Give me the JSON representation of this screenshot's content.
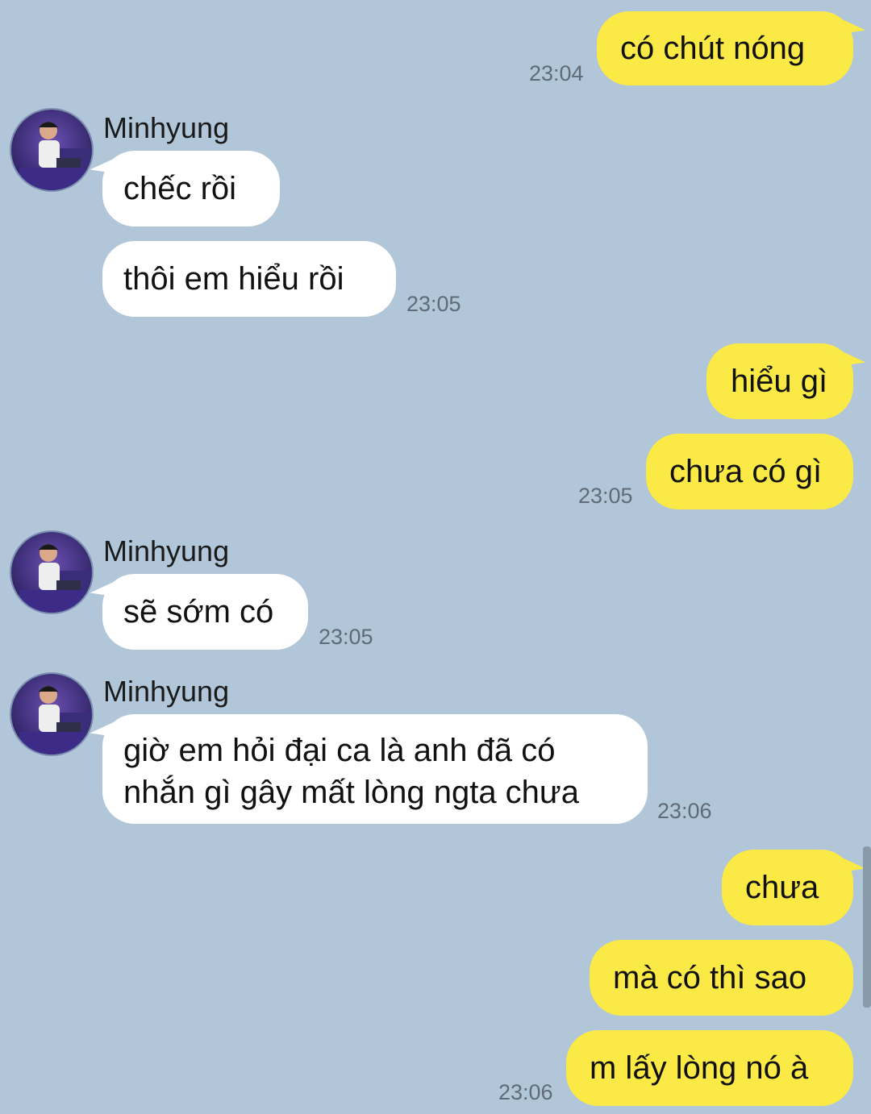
{
  "contact": {
    "name": "Minhyung",
    "avatar_icon": "contact-avatar-photo"
  },
  "colors": {
    "background": "#b1c6d9",
    "sent_bubble": "#fbea45",
    "received_bubble": "#ffffff"
  },
  "messages": [
    {
      "direction": "sent",
      "text": "có chút nóng",
      "time": "23:04"
    },
    {
      "direction": "received",
      "sender": "Minhyung",
      "text": "chếc rồi"
    },
    {
      "direction": "received",
      "text": "thôi em hiểu rồi",
      "time": "23:05"
    },
    {
      "direction": "sent",
      "text": "hiểu gì"
    },
    {
      "direction": "sent",
      "text": "chưa có gì",
      "time": "23:05"
    },
    {
      "direction": "received",
      "sender": "Minhyung",
      "text": "sẽ sớm có",
      "time": "23:05"
    },
    {
      "direction": "received",
      "sender": "Minhyung",
      "text": "giờ em hỏi đại ca là anh đã có\nnhắn gì gây mất lòng ngta chưa",
      "time": "23:06"
    },
    {
      "direction": "sent",
      "text": "chưa"
    },
    {
      "direction": "sent",
      "text": "mà có thì sao"
    },
    {
      "direction": "sent",
      "text": "m lấy lòng nó à",
      "time": "23:06"
    }
  ]
}
